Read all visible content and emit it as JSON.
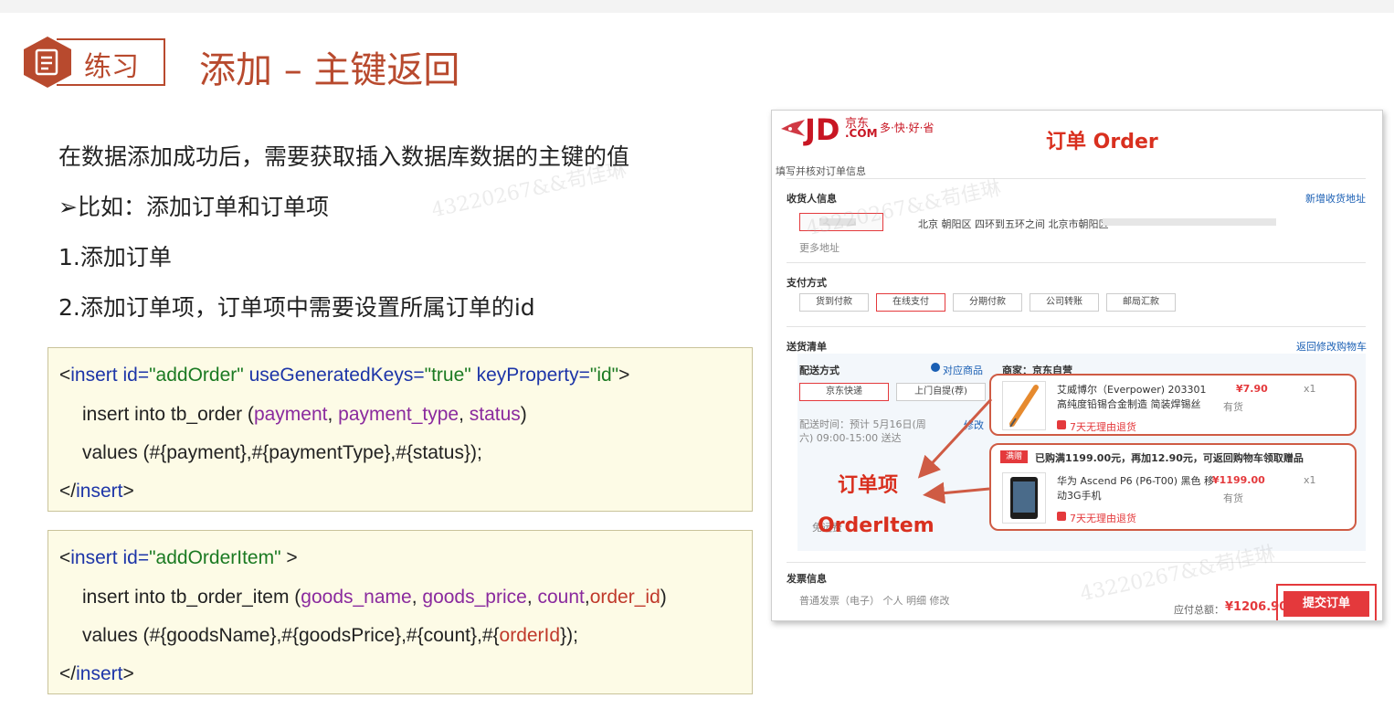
{
  "header": {
    "section_label": "练习",
    "title": "添加 – 主键返回"
  },
  "body": {
    "lines": [
      "在数据添加成功后，需要获取插入数据库数据的主键的值",
      "➢比如：添加订单和订单项",
      "1.添加订单",
      "2.添加订单项，订单项中需要设置所属订单的id"
    ]
  },
  "code1": {
    "line1": {
      "open": "<",
      "tag": "insert",
      "sp1": " ",
      "attr1": "id=",
      "val1": "\"addOrder\"",
      "sp2": " ",
      "attr2": "useGeneratedKeys=",
      "val2": "\"true\"",
      "sp3": " ",
      "attr3": "keyProperty=",
      "val3": "\"id\"",
      "close": ">"
    },
    "line2": {
      "text": "insert into tb_order (",
      "c1": "payment",
      "s1": ", ",
      "c2": "payment_type",
      "s2": ", ",
      "c3": "status",
      "end": ")"
    },
    "line3": "values (#{payment},#{paymentType},#{status});",
    "line4": {
      "open": "</",
      "tag": "insert",
      "close": ">"
    }
  },
  "code2": {
    "line1": {
      "open": "<",
      "tag": "insert",
      "sp1": " ",
      "attr1": "id=",
      "val1": "\"addOrderItem\"",
      "close": " >"
    },
    "line2": {
      "text": "insert into tb_order_item (",
      "c1": "goods_name",
      "s1": ", ",
      "c2": "goods_price",
      "s2": ", ",
      "c3": "count",
      "s3": ",",
      "c4": "order_id",
      "end": ")"
    },
    "line3": {
      "text": "values (#{goodsName},#{goodsPrice},#{count},#{",
      "hl": "orderId",
      "end": "});"
    },
    "line4": {
      "open": "</",
      "tag": "insert",
      "close": ">"
    }
  },
  "jd": {
    "logo": "JD",
    "logo_cn": "京东",
    "logo_com": ".COM",
    "slogan": "多·快·好·省",
    "order_title": "订单 Order",
    "step": "填写并核对订单信息",
    "receiver_title": "收货人信息",
    "add_address": "新增收货地址",
    "address": "北京 朝阳区 四环到五环之间 北京市朝阳区",
    "more_address": "更多地址",
    "payment_title": "支付方式",
    "payment_options": [
      "货到付款",
      "在线支付",
      "分期付款",
      "公司转账",
      "邮局汇款"
    ],
    "shipping_title": "送货清单",
    "back_to_cart": "返回修改购物车",
    "delivery_method": "配送方式",
    "matched_goods": "对应商品",
    "merchant": "商家：京东自营",
    "delivery_options": [
      "京东快递",
      "上门自提(荐)"
    ],
    "delivery_time": "配送时间：预计 5月16日(周六) 09:00-15:00 送达",
    "edit": "修改",
    "item1": {
      "name": "艾威博尔（Everpower) 203301 高纯度铅锡合金制造 简装焊锡丝",
      "price": "¥7.90",
      "qty": "x1",
      "stock": "有货",
      "returns": "7天无理由退货"
    },
    "promo_tag": "满赠",
    "promo": "已购满1199.00元，再加12.90元，可返回购物车领取赠品",
    "item2": {
      "name": "华为 Ascend P6 (P6-T00) 黑色 移动3G手机",
      "price": "¥1199.00",
      "qty": "x1",
      "stock": "有货",
      "returns": "7天无理由退货"
    },
    "invoice_title": "发票信息",
    "invoice_detail": "普通发票（电子）  个人  明细  修改",
    "total_label": "应付总额：",
    "total": "¥1206.90",
    "submit": "提交订单",
    "annot_item_cn": "订单项",
    "annot_item_en": "OrderItem",
    "stray_text": "免运费"
  },
  "watermark": "43220267&&苟佳琳",
  "colors": {
    "accent": "#b84a2e",
    "jd_red": "#e4393c",
    "code_bg": "#fdfbe6",
    "keyword": "#1d35a8",
    "string": "#1b7a22",
    "column": "#8a2a9e"
  }
}
